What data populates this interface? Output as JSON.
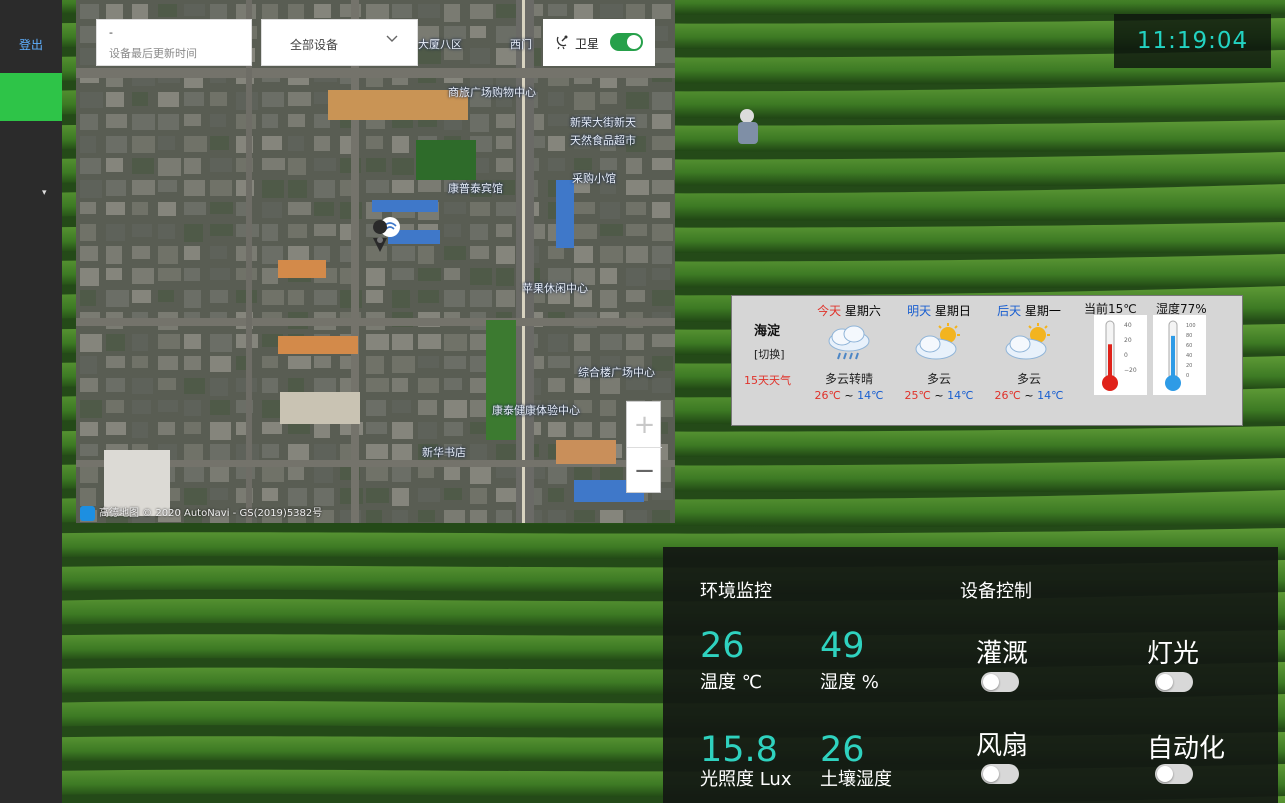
{
  "sidebar": {
    "logout_label": "登出",
    "caret": "▾"
  },
  "map": {
    "last_update_value": "-",
    "last_update_placeholder": "设备最后更新时间",
    "device_select_value": "全部设备",
    "satellite_label": "卫星",
    "satellite_on": true,
    "zoom_in": "+",
    "zoom_out": "−",
    "attribution": "高德地图 © 2020 AutoNavi - GS(2019)5382号",
    "labels": [
      "西门",
      "新荣大街新天",
      "天然食品超市",
      "康普泰宾馆",
      "采购小馆",
      "苹果休闲中心",
      "综合楼广场中心",
      "康泰健康体验中心",
      "新华书店",
      "商旅广场购物中心",
      "大厦八区"
    ]
  },
  "clock": {
    "time": "11:19:04"
  },
  "weather": {
    "city": "海淀",
    "switch_label": "[切换]",
    "forecast_label": "15天天气",
    "days": [
      {
        "tag": "今天",
        "weekday": "星期六",
        "cond": "多云转晴",
        "hi": "26℃",
        "lo": "14℃",
        "tag_color": "#e0322a",
        "icon": "cloud-rain-icon"
      },
      {
        "tag": "明天",
        "weekday": "星期日",
        "cond": "多云",
        "hi": "25℃",
        "lo": "14℃",
        "tag_color": "#1a5fd0",
        "icon": "cloud-sun-icon"
      },
      {
        "tag": "后天",
        "weekday": "星期一",
        "cond": "多云",
        "hi": "26℃",
        "lo": "14℃",
        "tag_color": "#1a5fd0",
        "icon": "cloud-sun-icon"
      }
    ],
    "tilde": "~",
    "current_temp_label": "当前15℃",
    "humidity_label": "湿度77%",
    "temperature_level": 0.62,
    "humidity_level": 0.77,
    "thermo_temp_ticks": [
      "40",
      "20",
      "0",
      "−20"
    ],
    "thermo_hum_ticks": [
      "100",
      "80",
      "60",
      "40",
      "20",
      "0"
    ]
  },
  "monitor": {
    "title": "环境监控",
    "metrics": [
      {
        "value": "26",
        "label": "温度 ℃"
      },
      {
        "value": "49",
        "label": "湿度 %"
      },
      {
        "value": "15.8",
        "label": "光照度 Lux"
      },
      {
        "value": "26",
        "label": "土壤湿度"
      }
    ]
  },
  "control": {
    "title": "设备控制",
    "devices": [
      {
        "label": "灌溉",
        "on": false
      },
      {
        "label": "灯光",
        "on": false
      },
      {
        "label": "风扇",
        "on": false
      },
      {
        "label": "自动化",
        "on": false
      }
    ]
  },
  "colors": {
    "accent": "#2ec448",
    "metric": "#2fd2bf",
    "clock": "#23d3c2",
    "hot": "#e0322a",
    "cold": "#1a5fd0"
  }
}
